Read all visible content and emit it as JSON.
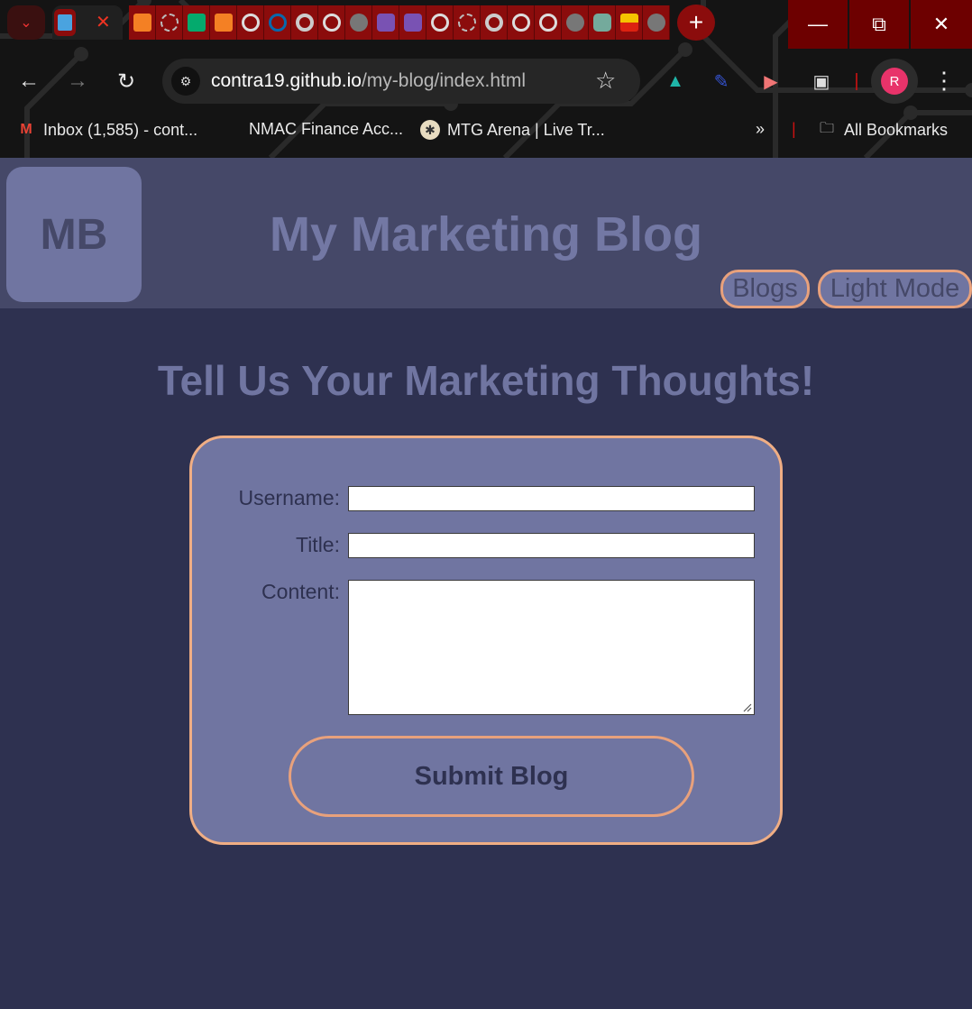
{
  "browser": {
    "url_host": "contra19.github.io",
    "url_path": "/my-blog/index.html",
    "new_tab_label": "+",
    "profile_initial": "R",
    "bookmarks": [
      {
        "label": "Inbox (1,585) - cont...",
        "icon": "gmail-icon"
      },
      {
        "label": "NMAC Finance Acc...",
        "icon": "none"
      },
      {
        "label": "MTG Arena | Live Tr...",
        "icon": "mtg-icon"
      }
    ],
    "bookmarks_overflow": "»",
    "all_bookmarks_label": "All Bookmarks"
  },
  "header": {
    "logo_text": "MB",
    "title": "My Marketing Blog",
    "nav": {
      "blogs_label": "Blogs",
      "mode_label": "Light Mode"
    }
  },
  "main": {
    "heading": "Tell Us Your Marketing Thoughts!",
    "form": {
      "username_label": "Username:",
      "username_value": "",
      "title_label": "Title:",
      "title_value": "",
      "content_label": "Content:",
      "content_value": "",
      "submit_label": "Submit Blog"
    }
  },
  "colors": {
    "page_bg": "#2e3150",
    "header_bg": "#454868",
    "accent": "#7075a1",
    "border": "#f0ae84"
  }
}
